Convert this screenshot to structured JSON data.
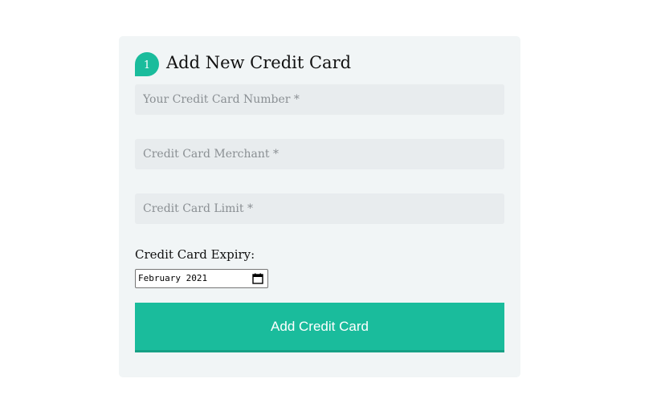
{
  "form": {
    "step_number": "1",
    "title": "Add New Credit Card",
    "card_number": {
      "placeholder": "Your Credit Card Number *",
      "value": ""
    },
    "merchant": {
      "placeholder": "Credit Card Merchant *",
      "value": ""
    },
    "limit": {
      "placeholder": "Credit Card Limit *",
      "value": ""
    },
    "expiry_label": "Credit Card Expiry:",
    "expiry_value": "February 2021",
    "submit_label": "Add Credit Card"
  },
  "colors": {
    "accent": "#1abc9c",
    "accent_dark": "#16a085",
    "panel_background": "#f1f5f6",
    "input_background": "#e8ecee"
  },
  "icons": {
    "expiry_picker": "calendar-icon"
  }
}
